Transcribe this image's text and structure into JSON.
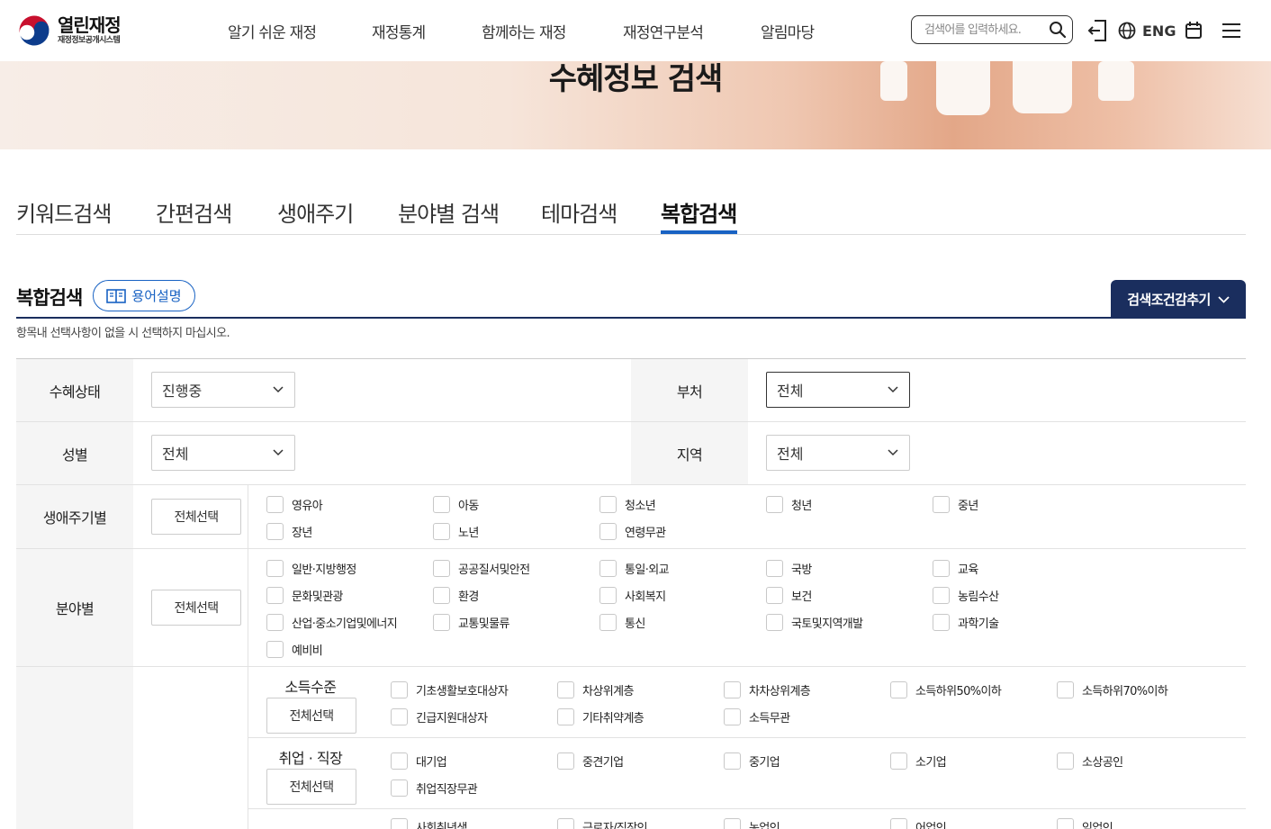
{
  "logo": {
    "title": "열린재정",
    "subtitle": "재정정보공개시스템"
  },
  "nav": [
    "알기 쉬운 재정",
    "재정통계",
    "함께하는 재정",
    "재정연구분석",
    "알림마당"
  ],
  "search": {
    "placeholder": "검색어를 입력하세요."
  },
  "header_icons": [
    "login-icon",
    "globe-icon",
    "calendar-icon",
    "menu-icon"
  ],
  "lang_label": "ENG",
  "banner": {
    "title": "수혜정보 검색"
  },
  "tabs": [
    "키워드검색",
    "간편검색",
    "생애주기",
    "분야별 검색",
    "테마검색",
    "복합검색"
  ],
  "active_tab": "복합검색",
  "section": {
    "title": "복합검색",
    "glossary_label": "용어설명",
    "collapse_label": "검색조건감추기",
    "notice": "항목내 선택사항이 없을 시 선택하지 마십시오."
  },
  "form": {
    "status": {
      "label": "수혜상태",
      "value": "진행중"
    },
    "ministry": {
      "label": "부처",
      "value": "전체"
    },
    "gender": {
      "label": "성별",
      "value": "전체"
    },
    "region": {
      "label": "지역",
      "value": "전체"
    },
    "select_all": "전체선택",
    "lifecycle": {
      "label": "생애주기별",
      "items": [
        "영유아",
        "아동",
        "청소년",
        "청년",
        "중년",
        "장년",
        "노년",
        "연령무관"
      ]
    },
    "field": {
      "label": "분야별",
      "items": [
        "일반·지방행정",
        "공공질서및안전",
        "통일·외교",
        "국방",
        "교육",
        "문화및관광",
        "환경",
        "사회복지",
        "보건",
        "농림수산",
        "산업·중소기업및에너지",
        "교통및물류",
        "통신",
        "국토및지역개발",
        "과학기술",
        "예비비"
      ]
    },
    "income": {
      "label": "소득수준",
      "items": [
        "기초생활보호대상자",
        "차상위계층",
        "차차상위계층",
        "소득하위50%이하",
        "소득하위70%이하",
        "긴급지원대상자",
        "기타취약계층",
        "소득무관"
      ]
    },
    "employment": {
      "label": "취업 · 직장",
      "items": [
        "대기업",
        "중견기업",
        "중기업",
        "소기업",
        "소상공인",
        "취업직장무관"
      ]
    },
    "partial_row": {
      "items": [
        "사회취년생",
        "근로자/직장인",
        "농업인",
        "어업인",
        "임업인"
      ]
    }
  },
  "colors": {
    "accent": "#1862c3",
    "navy": "#1a2e5e"
  }
}
